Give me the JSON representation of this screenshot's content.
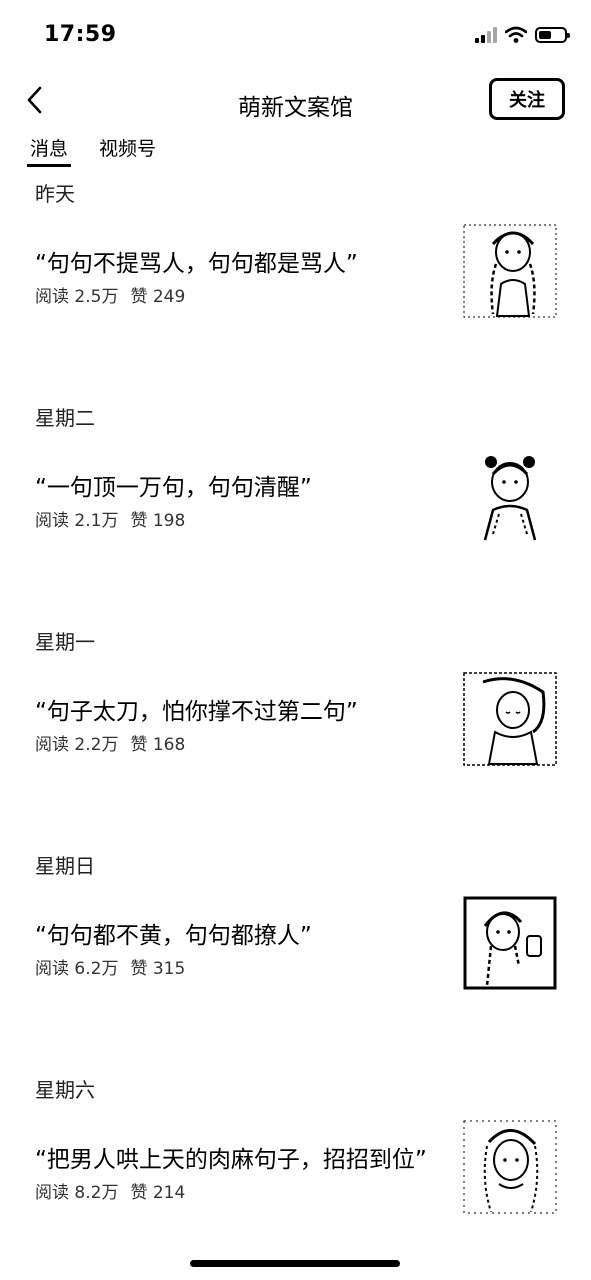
{
  "status_bar": {
    "time": "17:59"
  },
  "nav": {
    "title": "萌新文案馆",
    "follow_label": "关注"
  },
  "tabs": [
    {
      "label": "消息",
      "active": true
    },
    {
      "label": "视频号",
      "active": false
    }
  ],
  "groups": [
    {
      "date": "昨天",
      "title": "“句句不提骂人，句句都是骂人”",
      "read_label": "阅读",
      "reads": "2.5万",
      "like_label": "赞",
      "likes": "249"
    },
    {
      "date": "星期二",
      "title": "“一句顶一万句，句句清醒”",
      "read_label": "阅读",
      "reads": "2.1万",
      "like_label": "赞",
      "likes": "198"
    },
    {
      "date": "星期一",
      "title": "“句子太刀，怕你撑不过第二句”",
      "read_label": "阅读",
      "reads": "2.2万",
      "like_label": "赞",
      "likes": "168"
    },
    {
      "date": "星期日",
      "title": "“句句都不黄，句句都撩人”",
      "read_label": "阅读",
      "reads": "6.2万",
      "like_label": "赞",
      "likes": "315"
    },
    {
      "date": "星期六",
      "title": "“把男人哄上天的肉麻句子，招招到位”",
      "read_label": "阅读",
      "reads": "8.2万",
      "like_label": "赞",
      "likes": "214"
    }
  ],
  "icons": {
    "back": "chevron-left-icon",
    "wifi": "wifi-icon",
    "signal": "signal-icon",
    "battery": "battery-icon"
  }
}
